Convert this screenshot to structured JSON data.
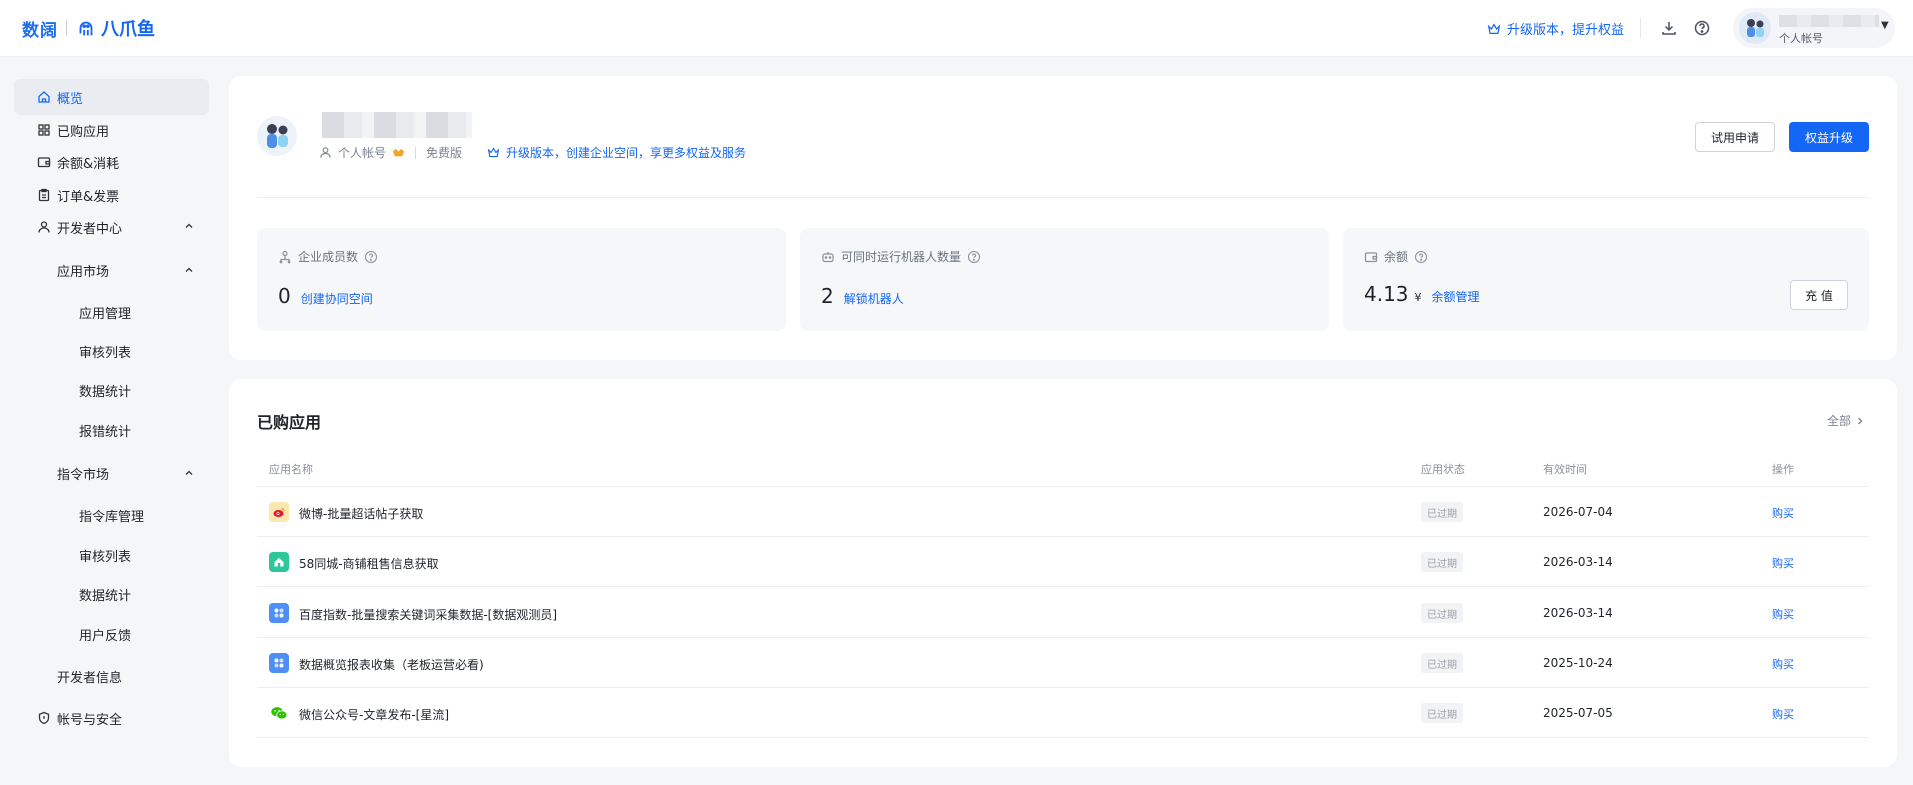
{
  "topbar": {
    "logo_left": "数阔",
    "logo_right": "八爪鱼",
    "upgrade_text": "升级版本，提升权益",
    "user_type": "个人帐号"
  },
  "sidebar": {
    "items": [
      {
        "label": "概览",
        "icon": "home-icon",
        "active": true
      },
      {
        "label": "已购应用",
        "icon": "grid-icon"
      },
      {
        "label": "余额&消耗",
        "icon": "wallet-icon"
      },
      {
        "label": "订单&发票",
        "icon": "clipboard-icon"
      },
      {
        "label": "开发者中心",
        "icon": "user-icon"
      }
    ],
    "dev_center": {
      "app_market": {
        "label": "应用市场",
        "children": [
          "应用管理",
          "审核列表",
          "数据统计",
          "报错统计"
        ]
      },
      "cmd_market": {
        "label": "指令市场",
        "children": [
          "指令库管理",
          "审核列表",
          "数据统计",
          "用户反馈"
        ]
      },
      "dev_info": "开发者信息"
    },
    "account_security": {
      "label": "帐号与安全",
      "icon": "shield-icon"
    }
  },
  "profile": {
    "account_type": "个人帐号",
    "plan": "免费版",
    "upgrade_text": "升级版本，创建企业空间，享更多权益及服务",
    "trial_button": "试用申请",
    "upgrade_button": "权益升级"
  },
  "stats": [
    {
      "title": "企业成员数",
      "icon": "members-icon",
      "value": "0",
      "link": "创建协同空间"
    },
    {
      "title": "可同时运行机器人数量",
      "icon": "robot-icon",
      "value": "2",
      "link": "解锁机器人"
    },
    {
      "title": "余额",
      "icon": "wallet-icon",
      "value": "4.13",
      "unit": "¥",
      "link": "余额管理",
      "button": "充 值"
    }
  ],
  "apps": {
    "title": "已购应用",
    "all_link": "全部",
    "columns": [
      "应用名称",
      "应用状态",
      "有效时间",
      "操作"
    ],
    "rows": [
      {
        "name": "微博-批量超话帖子获取",
        "status": "已过期",
        "date": "2026-07-04",
        "action": "购买",
        "icon": "weibo-icon",
        "color": "#fbe7b0"
      },
      {
        "name": "58同城-商铺租售信息获取",
        "status": "已过期",
        "date": "2026-03-14",
        "action": "购买",
        "icon": "house-icon",
        "color": "#2fc79a"
      },
      {
        "name": "百度指数-批量搜索关键词采集数据-[数据观测员]",
        "status": "已过期",
        "date": "2026-03-14",
        "action": "购买",
        "icon": "app-icon",
        "color": "#4d8ff7"
      },
      {
        "name": "数据概览报表收集（老板运营必看)",
        "status": "已过期",
        "date": "2025-10-24",
        "action": "购买",
        "icon": "app-icon",
        "color": "#4d8ff7"
      },
      {
        "name": "微信公众号-文章发布-[星流]",
        "status": "已过期",
        "date": "2025-07-05",
        "action": "购买",
        "icon": "wechat-icon",
        "color": "#ffffff"
      }
    ]
  }
}
